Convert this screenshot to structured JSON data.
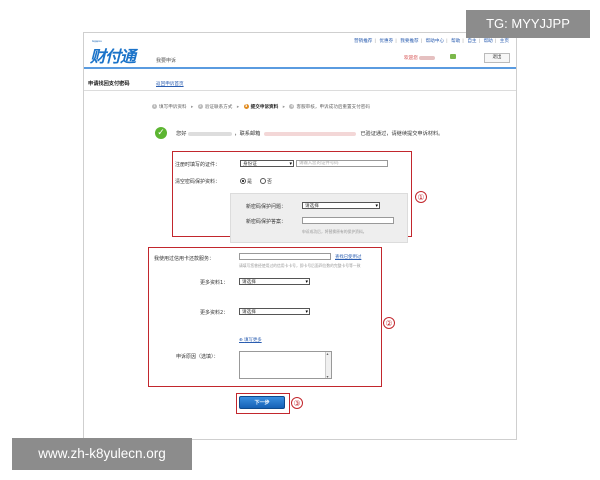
{
  "header": {
    "logo_text": "财付通",
    "logo_small": "tenpay.com",
    "page_label": "我要申诉",
    "top_links": [
      "营销推荐",
      "优惠券",
      "我要推荐",
      "帮助中心",
      "帮助",
      "自主",
      "帮助",
      "主页"
    ],
    "welcome_prefix": "欢迎您",
    "login_button": "退出"
  },
  "section": {
    "title": "申请找回支付密码",
    "back_link": "返回申诉首页"
  },
  "steps": [
    {
      "num": "1",
      "label": "填写申诉资料"
    },
    {
      "num": "2",
      "label": "验证联系方式"
    },
    {
      "num": "3",
      "label": "提交申诉资料"
    },
    {
      "num": "4",
      "label": "客服审核，申诉成功后重置支付密码"
    }
  ],
  "verified": {
    "greeting": "您好",
    "contact_email": "，联系邮箱",
    "message": "已验证通过，请继续提交申诉材料。"
  },
  "form1": {
    "id_label": "注册时填写的证件：",
    "id_type": "身份证",
    "id_placeholder": "请输入您的证件号码",
    "clear_label": "清空密码保护资料：",
    "yes": "是",
    "no": "否",
    "new_q_label": "新密码保护问题：",
    "new_q_value": "请选择",
    "new_a_label": "新密码保护答案：",
    "hint": "申诉成功后，将替换原有的保护资料。"
  },
  "form2": {
    "card_label": "我使用过信用卡还款服务：",
    "card_link": "查找已使用过",
    "card_hint": "请填写您曾经使用过的信用卡卡号，即卡号后面四位数的完整卡号等一致",
    "more1_label": "更多资料1：",
    "more1_value": "请选择",
    "more2_label": "更多资料2：",
    "more2_value": "请选择",
    "more_link": "填写更多",
    "reason_label": "申诉原因（选填）："
  },
  "next_button": "下一步",
  "markers": [
    "①",
    "②",
    "③"
  ],
  "watermarks": {
    "tg": "TG: MYYJJPP",
    "site": "www.zh-k8yulecn.org"
  }
}
